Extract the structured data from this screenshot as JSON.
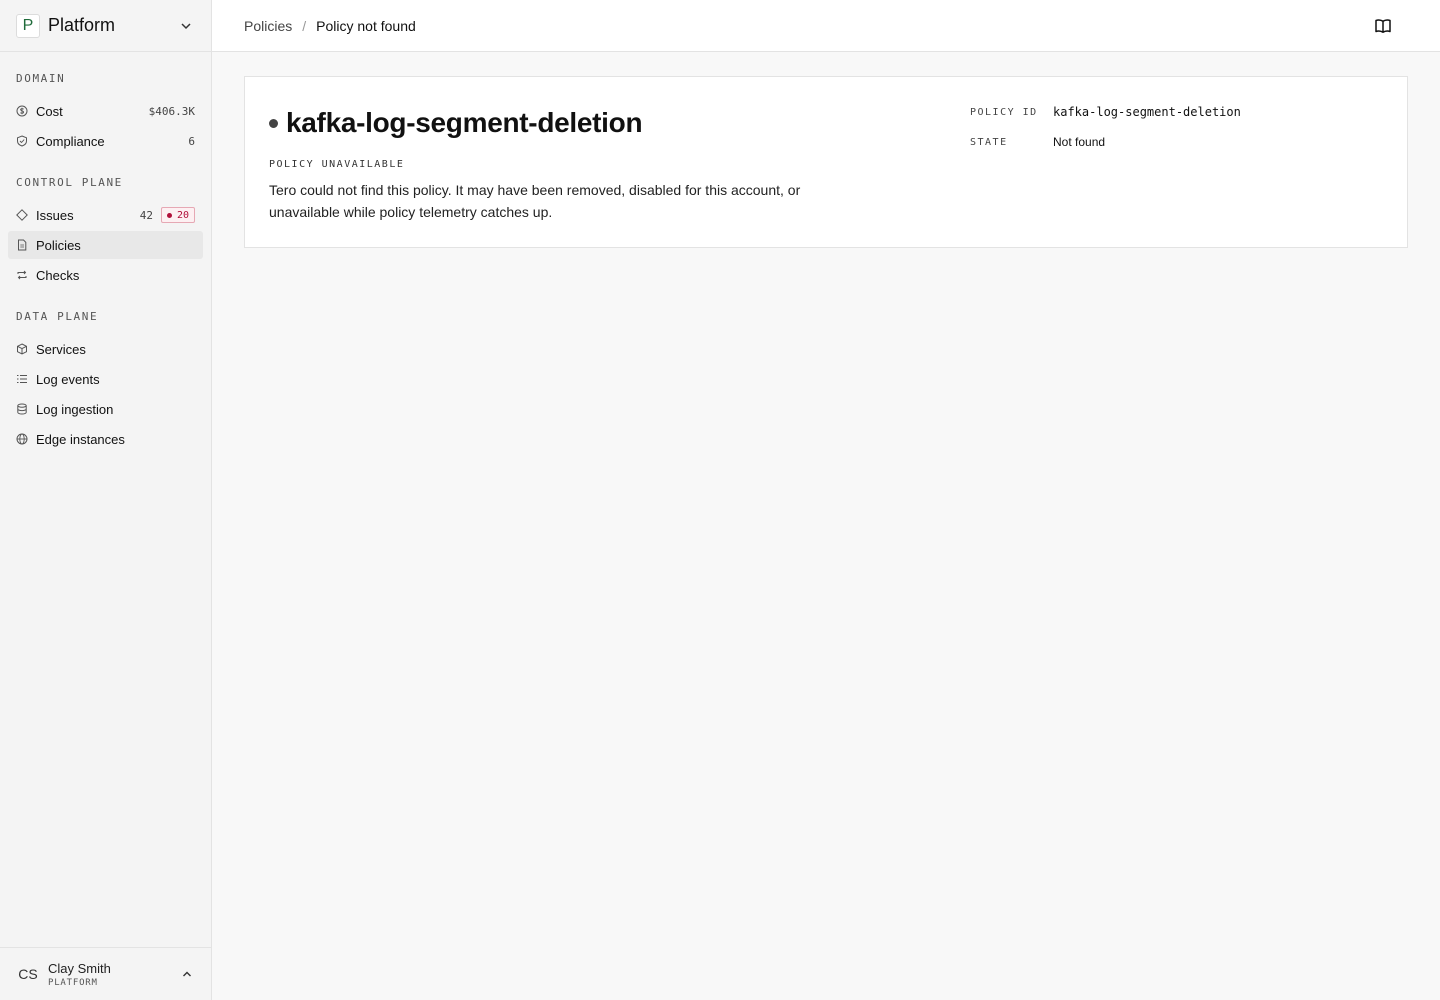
{
  "sidebar": {
    "workspace": {
      "initial": "P",
      "name": "Platform"
    },
    "sections": {
      "domain": "DOMAIN",
      "control_plane": "CONTROL PLANE",
      "data_plane": "DATA PLANE"
    },
    "items": {
      "cost": {
        "label": "Cost",
        "value": "$406.3K",
        "icon": "dollar-circle-icon"
      },
      "compliance": {
        "label": "Compliance",
        "value": "6",
        "icon": "shield-icon"
      },
      "issues": {
        "label": "Issues",
        "count": "42",
        "badge": "20",
        "icon": "diamond-icon"
      },
      "policies": {
        "label": "Policies",
        "icon": "document-icon",
        "active": true
      },
      "checks": {
        "label": "Checks",
        "icon": "refresh-arrows-icon"
      },
      "services": {
        "label": "Services",
        "icon": "cube-icon"
      },
      "log_events": {
        "label": "Log events",
        "icon": "list-icon"
      },
      "log_ingestion": {
        "label": "Log ingestion",
        "icon": "database-icon"
      },
      "edge_instances": {
        "label": "Edge instances",
        "icon": "globe-icon"
      }
    },
    "user": {
      "initials": "CS",
      "name": "Clay Smith",
      "org": "PLATFORM"
    }
  },
  "header": {
    "breadcrumb_parent": "Policies",
    "breadcrumb_separator": "/",
    "breadcrumb_current": "Policy not found",
    "docs_icon": "book-open-icon"
  },
  "policy": {
    "title": "kafka-log-segment-deletion",
    "status_label": "POLICY UNAVAILABLE",
    "description": "Tero could not find this policy. It may have been removed, disabled for this account, or unavailable while policy telemetry catches up.",
    "meta": {
      "policy_id_key": "POLICY ID",
      "policy_id_value": "kafka-log-segment-deletion",
      "state_key": "STATE",
      "state_value": "Not found"
    }
  },
  "colors": {
    "badge_red": "#b0103a",
    "logo_green": "#1f6b3a",
    "active_bg": "#e8e8e8"
  }
}
